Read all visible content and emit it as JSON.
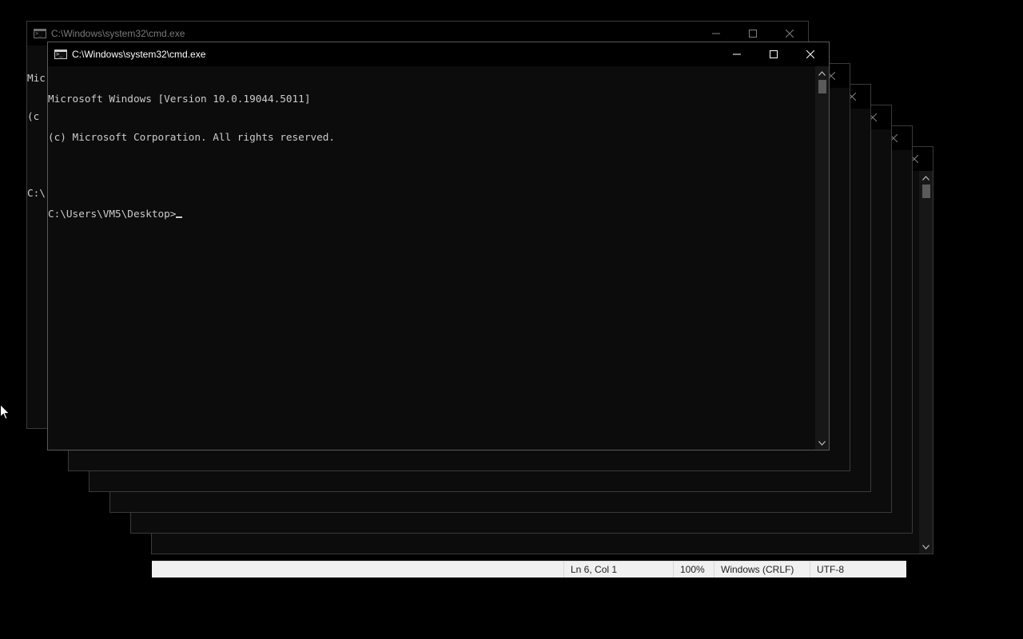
{
  "windows": {
    "back_title": "C:\\Windows\\system32\\cmd.exe",
    "back_partial_lines": [
      "Mic",
      "(c",
      "",
      "C:\\"
    ],
    "front_title": "C:\\Windows\\system32\\cmd.exe",
    "front_lines": [
      "Microsoft Windows [Version 10.0.19044.5011]",
      "(c) Microsoft Corporation. All rights reserved.",
      ""
    ],
    "front_prompt": "C:\\Users\\VM5\\Desktop>"
  },
  "statusbar": {
    "position": "Ln 6, Col 1",
    "zoom": "100%",
    "line_ending": "Windows (CRLF)",
    "encoding": "UTF-8"
  },
  "icons": {
    "app": "cmd-icon",
    "minimize": "minimize-icon",
    "maximize": "maximize-icon",
    "close": "close-icon",
    "scroll_up": "chevron-up-icon",
    "scroll_down": "chevron-down-icon",
    "pointer": "mouse-pointer-icon"
  },
  "colors": {
    "console_bg": "#0c0c0c",
    "console_text": "#cccccc",
    "desktop": "#000000"
  }
}
